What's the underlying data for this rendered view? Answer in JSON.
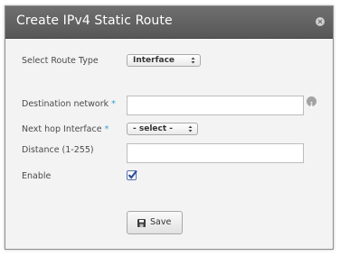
{
  "dialog": {
    "title": "Create IPv4 Static Route",
    "close_icon": "close-icon"
  },
  "form": {
    "route_type": {
      "label": "Select Route Type",
      "value": "Interface"
    },
    "destination_network": {
      "label": "Destination network",
      "required_marker": "*",
      "value": ""
    },
    "next_hop_interface": {
      "label": "Next hop Interface",
      "required_marker": "*",
      "value": "- select -"
    },
    "distance": {
      "label": "Distance (1-255)",
      "value": ""
    },
    "enable": {
      "label": "Enable",
      "checked": true
    }
  },
  "footer": {
    "save_label": "Save",
    "save_icon": "floppy-disk-icon"
  },
  "colors": {
    "titlebar": "#5f5f5f",
    "required_marker": "#3a9ad9",
    "checkbox_check": "#2f4f9e"
  }
}
